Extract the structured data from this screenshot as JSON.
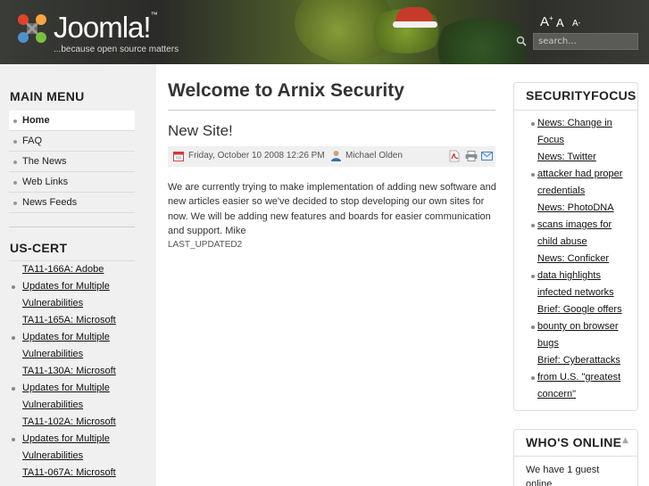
{
  "header": {
    "logo_text": "Joomla!",
    "logo_trademark": "™",
    "tagline": "...because open source matters",
    "font_controls": {
      "increase": "A",
      "increase_sup": "+",
      "reset": "A",
      "decrease": "A",
      "decrease_sup": "-"
    },
    "search_placeholder": "search..."
  },
  "left": {
    "main_menu_title": "MAIN MENU",
    "main_menu": [
      {
        "label": "Home",
        "active": true
      },
      {
        "label": "FAQ"
      },
      {
        "label": "The News"
      },
      {
        "label": "Web Links"
      },
      {
        "label": "News Feeds"
      }
    ],
    "uscert_title": "US-CERT",
    "uscert_lines": [
      "TA11-166A: Adobe",
      "Updates for Multiple",
      "Vulnerabilities",
      "TA11-165A: Microsoft",
      "Updates for Multiple",
      "Vulnerabilities",
      "TA11-130A: Microsoft",
      "Updates for Multiple",
      "Vulnerabilities",
      "TA11-102A: Microsoft",
      "Updates for Multiple",
      "Vulnerabilities",
      "TA11-067A: Microsoft"
    ]
  },
  "main": {
    "page_title": "Welcome to Arnix Security",
    "article_title": "New Site!",
    "date": "Friday, October 10 2008 12:26 PM",
    "author": "Michael Olden",
    "body": "We are currently trying to make implementation of adding new software and new articles easier so we've decided to stop developing our own sites for now. We will be adding new features and boards for easier communication and support. Mike",
    "last_updated": "LAST_UPDATED2"
  },
  "right": {
    "securityfocus_title": "SECURITYFOCUS",
    "securityfocus_lines": [
      "News: Change in",
      "Focus",
      "News: Twitter",
      "attacker had proper",
      "credentials",
      "News: PhotoDNA",
      "scans images for",
      "child abuse",
      "News: Conficker",
      "data highlights",
      "infected networks",
      "Brief: Google offers",
      "bounty on browser",
      "bugs",
      "Brief: Cyberattacks",
      "from U.S. \"greatest",
      "concern\""
    ],
    "whos_online_title": "WHO'S ONLINE",
    "whos_online_text": "We have 1 guest online"
  },
  "colors": {
    "header_dark": "#3a3c38",
    "left_bg": "#f0f0f0",
    "text": "#333333"
  }
}
